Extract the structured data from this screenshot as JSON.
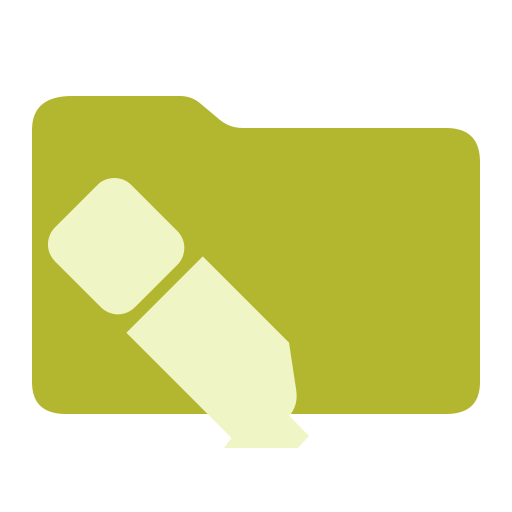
{
  "icon": {
    "name": "folder-highlighter-icon",
    "folder_color": "#b2b72f",
    "highlighter_color": "#f0f5c6"
  }
}
